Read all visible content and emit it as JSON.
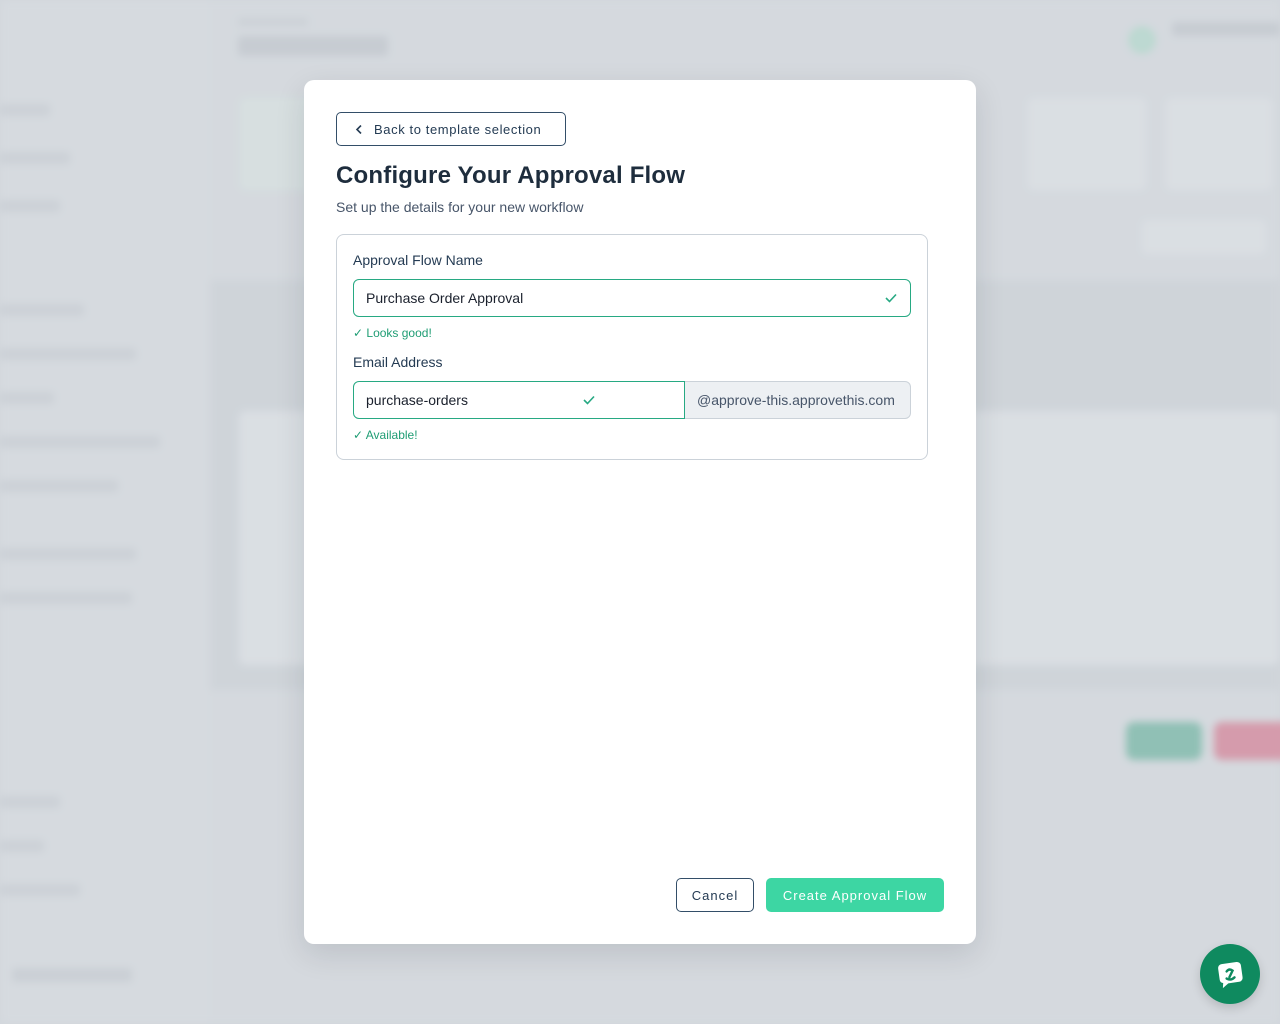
{
  "modal": {
    "back_label": "Back to template selection",
    "title": "Configure Your Approval Flow",
    "subtitle": "Set up the details for your new workflow",
    "name_field": {
      "label": "Approval Flow Name",
      "value": "Purchase Order Approval",
      "helper": "✓ Looks good!"
    },
    "email_field": {
      "label": "Email Address",
      "value": "purchase-orders",
      "suffix": "@approve-this.approvethis.com",
      "helper": "✓ Available!"
    },
    "cancel_label": "Cancel",
    "create_label": "Create Approval Flow"
  },
  "icons": {
    "back": "chevron-left-icon",
    "valid": "check-icon",
    "chat": "chat-icon"
  },
  "colors": {
    "accent": "#3dd6a3",
    "valid_border": "#27a983",
    "success_text": "#1f9d74",
    "chat_fab": "#0f8a5f"
  }
}
